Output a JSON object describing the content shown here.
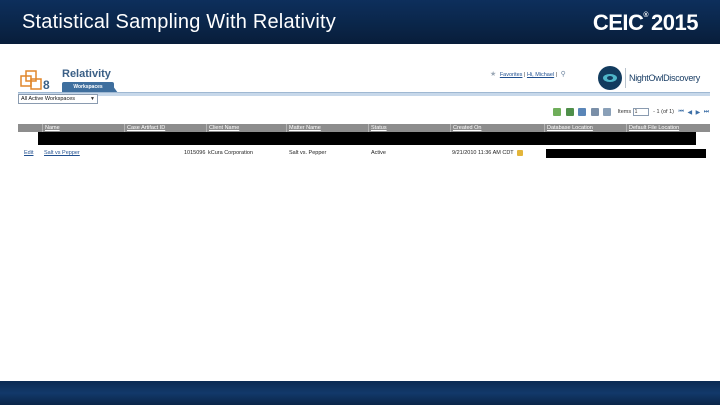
{
  "slide": {
    "title": "Statistical Sampling With Relativity",
    "brand_name": "CEIC",
    "brand_mark": "®",
    "brand_year": "2015"
  },
  "app": {
    "logo_text": "Relativity",
    "tab_label": "Workspaces",
    "header": {
      "favorites": "Favorites",
      "separator": "|",
      "greeting": "Hi, Michael"
    },
    "partner_logo": "NightOwlDiscovery",
    "workspace_select": "All Active Workspaces",
    "toolbar": {
      "items_label": "Items",
      "items_value": "1",
      "items_count": "- 1 (of 1)"
    },
    "columns": [
      "Name",
      "Case Artifact ID",
      "Client Name",
      "Matter Name",
      "Status",
      "Created On",
      "Database Location",
      "Default File Location"
    ],
    "rows": [
      {
        "edit": "Edit",
        "name": "Salt vs Pepper",
        "artifact_id": "1015096",
        "client": "kCura Corporation",
        "matter": "Salt vs. Pepper",
        "status": "Active",
        "created": "9/21/2010 11:36 AM CDT"
      }
    ]
  },
  "colors": {
    "banner": "#0a2548",
    "tab": "#3f6f9e",
    "grid_header": "#8d8d8d"
  }
}
